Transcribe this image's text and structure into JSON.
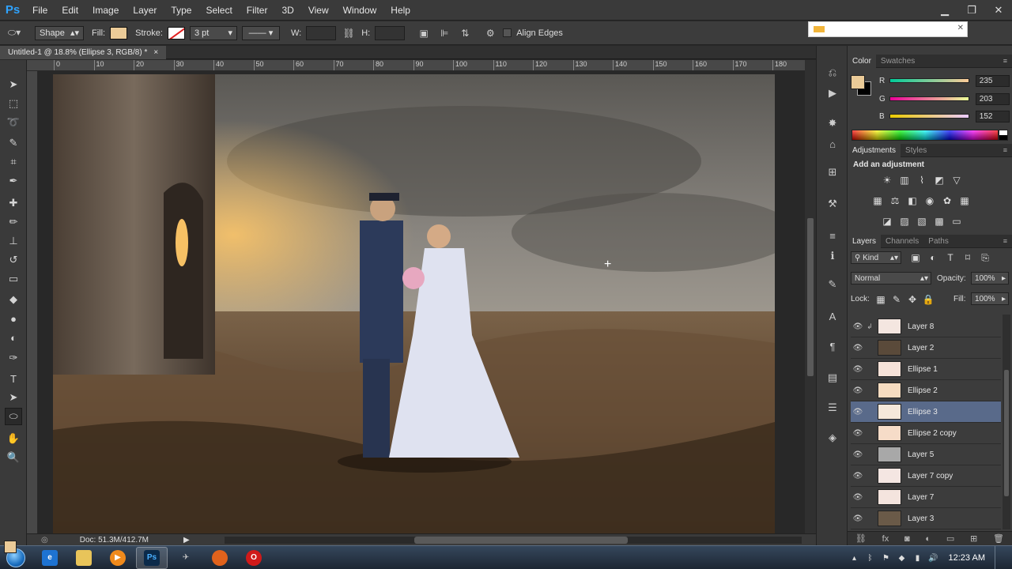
{
  "app": {
    "logo": "Ps"
  },
  "menu": [
    "File",
    "Edit",
    "Image",
    "Layer",
    "Type",
    "Select",
    "Filter",
    "3D",
    "View",
    "Window",
    "Help"
  ],
  "window_controls": {
    "minimize": "▁",
    "restore": "❐",
    "close": "✕"
  },
  "options": {
    "tool_mode": "Shape",
    "fill_label": "Fill:",
    "fill_color": "#ebcb98",
    "stroke_label": "Stroke:",
    "stroke_width": "3 pt",
    "w_label": "W:",
    "h_label": "H:",
    "align_edges": "Align Edges"
  },
  "document": {
    "tab_title": "Untitled-1 @ 18.8% (Ellipse 3, RGB/8) *",
    "close": "×"
  },
  "ruler": {
    "top_ticks": [
      "0",
      "10",
      "20",
      "30",
      "40",
      "50",
      "60",
      "70",
      "80",
      "90",
      "100",
      "110",
      "120",
      "130",
      "140",
      "150",
      "160",
      "170",
      "180"
    ]
  },
  "status": {
    "doc": "Doc: 51.3M/412.7M"
  },
  "tools": [
    {
      "name": "move",
      "glyph": "➤"
    },
    {
      "name": "rect-marquee",
      "glyph": "⬚"
    },
    {
      "name": "lasso",
      "glyph": "➰"
    },
    {
      "name": "quick-select",
      "glyph": "✎"
    },
    {
      "name": "crop",
      "glyph": "⌗"
    },
    {
      "name": "eyedropper",
      "glyph": "✒"
    },
    {
      "name": "healing",
      "glyph": "✚"
    },
    {
      "name": "brush",
      "glyph": "✏"
    },
    {
      "name": "stamp",
      "glyph": "⊥"
    },
    {
      "name": "history-brush",
      "glyph": "↺"
    },
    {
      "name": "eraser",
      "glyph": "▭"
    },
    {
      "name": "paint-bucket",
      "glyph": "◆"
    },
    {
      "name": "blur",
      "glyph": "●"
    },
    {
      "name": "dodge",
      "glyph": "◐"
    },
    {
      "name": "pen",
      "glyph": "✑"
    },
    {
      "name": "type",
      "glyph": "T"
    },
    {
      "name": "path-select",
      "glyph": "➤"
    },
    {
      "name": "ellipse",
      "glyph": "⬭"
    },
    {
      "name": "hand",
      "glyph": "✋"
    },
    {
      "name": "zoom",
      "glyph": "🔍"
    }
  ],
  "colors": {
    "foreground": "#ebcb98",
    "background": "#000000"
  },
  "color_panel": {
    "tabs": [
      "Color",
      "Swatches"
    ],
    "r_label": "R",
    "r_value": "235",
    "g_label": "G",
    "g_value": "203",
    "b_label": "B",
    "b_value": "152"
  },
  "adjustments_panel": {
    "tabs": [
      "Adjustments",
      "Styles"
    ],
    "title": "Add an adjustment"
  },
  "layers_panel": {
    "tabs": [
      "Layers",
      "Channels",
      "Paths"
    ],
    "filter_kind": "Kind",
    "blend_mode": "Normal",
    "opacity_label": "Opacity:",
    "opacity": "100%",
    "lock_label": "Lock:",
    "fill_label": "Fill:",
    "fill": "100%",
    "layers": [
      {
        "name": "Layer 8",
        "thumb": "#f4e6e0",
        "selected": false
      },
      {
        "name": "Layer 2",
        "thumb": "#5a4a3a",
        "selected": false
      },
      {
        "name": "Ellipse 1",
        "thumb": "#f6e2d8",
        "selected": false
      },
      {
        "name": "Ellipse 2",
        "thumb": "#f6dcc0",
        "selected": false
      },
      {
        "name": "Ellipse 3",
        "thumb": "#f5e8da",
        "selected": true
      },
      {
        "name": "Ellipse 2 copy",
        "thumb": "#f6dcc8",
        "selected": false
      },
      {
        "name": "Layer 5",
        "thumb": "#a8a8a8",
        "selected": false
      },
      {
        "name": "Layer 7 copy",
        "thumb": "#f4e6e2",
        "selected": false
      },
      {
        "name": "Layer 7",
        "thumb": "#f4e4de",
        "selected": false
      },
      {
        "name": "Layer 3",
        "thumb": "#6a5a48",
        "selected": false
      }
    ]
  },
  "taskbar": {
    "time": "12:23 AM"
  }
}
